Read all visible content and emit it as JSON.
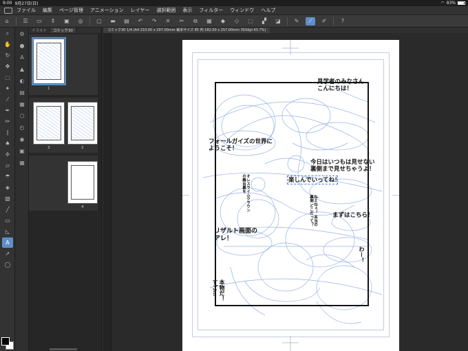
{
  "status": {
    "time": "9:00",
    "date": "9月27日(日)",
    "battery": "93%",
    "battery_level": 0.93
  },
  "menu": [
    {
      "label": "ファイル"
    },
    {
      "label": "編集"
    },
    {
      "label": "ページ管理"
    },
    {
      "label": "アニメーション"
    },
    {
      "label": "レイヤー"
    },
    {
      "label": "選択範囲"
    },
    {
      "label": "表示"
    },
    {
      "label": "フィルター"
    },
    {
      "label": "ウィンドウ"
    },
    {
      "label": "ヘルプ"
    }
  ],
  "page_panel": {
    "tabs": [
      "イラスト",
      "コミック30"
    ],
    "pages": [
      {
        "label": "1"
      },
      {
        "label": "3"
      },
      {
        "label": "2"
      },
      {
        "label": "4"
      }
    ]
  },
  "document": {
    "tab_label": "コミック30 1/4 (A4 210.00 x 297.00mm 裁本サイズ 85 判 182.00 x 257.00mm 350dpi 43.7%)"
  },
  "canvas_text": {
    "t1": "見学者のみなさん\nこんにちは！",
    "t2": "フォールガイズの世界に\nようこそ！",
    "t3": "今日はいつもは見せない\n裏側まで見せちゃうよ！",
    "t4": "楽しんでいってね！",
    "t5": "まずはこちら！",
    "t6": "リザルト画面の\nアレ！",
    "t7": "わー！",
    "t8": "本物だ！\nすご…",
    "v1": "オレスライムクラウンの舞台裏を",
    "v2": "ねえねぇ！ 本当の裏側 どこだって？"
  }
}
